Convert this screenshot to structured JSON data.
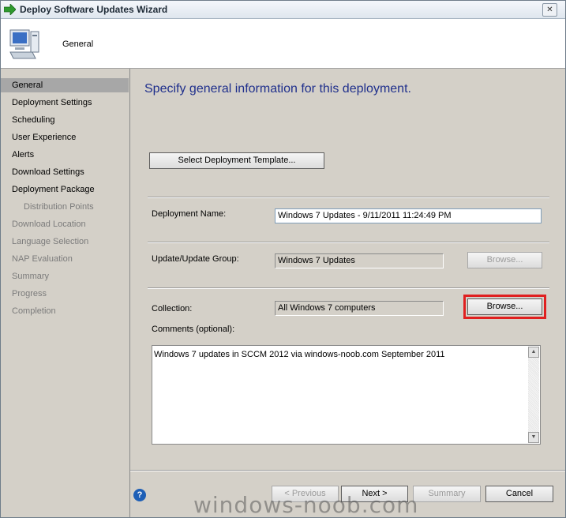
{
  "window": {
    "title": "Deploy Software Updates Wizard",
    "close_glyph": "✕"
  },
  "header": {
    "title": "General"
  },
  "sidebar": {
    "items": [
      {
        "label": "General",
        "state": "active"
      },
      {
        "label": "Deployment Settings",
        "state": "normal"
      },
      {
        "label": "Scheduling",
        "state": "normal"
      },
      {
        "label": "User Experience",
        "state": "normal"
      },
      {
        "label": "Alerts",
        "state": "normal"
      },
      {
        "label": "Download Settings",
        "state": "normal"
      },
      {
        "label": "Deployment Package",
        "state": "normal"
      },
      {
        "label": "Distribution Points",
        "state": "disabled"
      },
      {
        "label": "Download Location",
        "state": "disabled"
      },
      {
        "label": "Language Selection",
        "state": "disabled"
      },
      {
        "label": "NAP Evaluation",
        "state": "disabled"
      },
      {
        "label": "Summary",
        "state": "disabled"
      },
      {
        "label": "Progress",
        "state": "disabled"
      },
      {
        "label": "Completion",
        "state": "disabled"
      }
    ]
  },
  "main": {
    "heading": "Specify general information for this deployment.",
    "select_template_label": "Select Deployment Template...",
    "deployment_name_label": "Deployment Name:",
    "deployment_name_value": "Windows 7 Updates - 9/11/2011 11:24:49 PM",
    "update_group_label": "Update/Update Group:",
    "update_group_value": "Windows 7 Updates",
    "browse_update_label": "Browse...",
    "collection_label": "Collection:",
    "collection_value": "All Windows 7 computers",
    "browse_collection_label": "Browse...",
    "comments_label": "Comments (optional):",
    "comments_value": "Windows 7 updates in SCCM 2012 via windows-noob.com September 2011"
  },
  "footer": {
    "help_glyph": "?",
    "previous_label": "< Previous",
    "next_label": "Next >",
    "summary_label": "Summary",
    "cancel_label": "Cancel"
  },
  "watermark": "windows-noob.com",
  "colors": {
    "heading": "#1f2f8c",
    "highlight": "#e02020",
    "active_nav": "#a7a7a7"
  }
}
